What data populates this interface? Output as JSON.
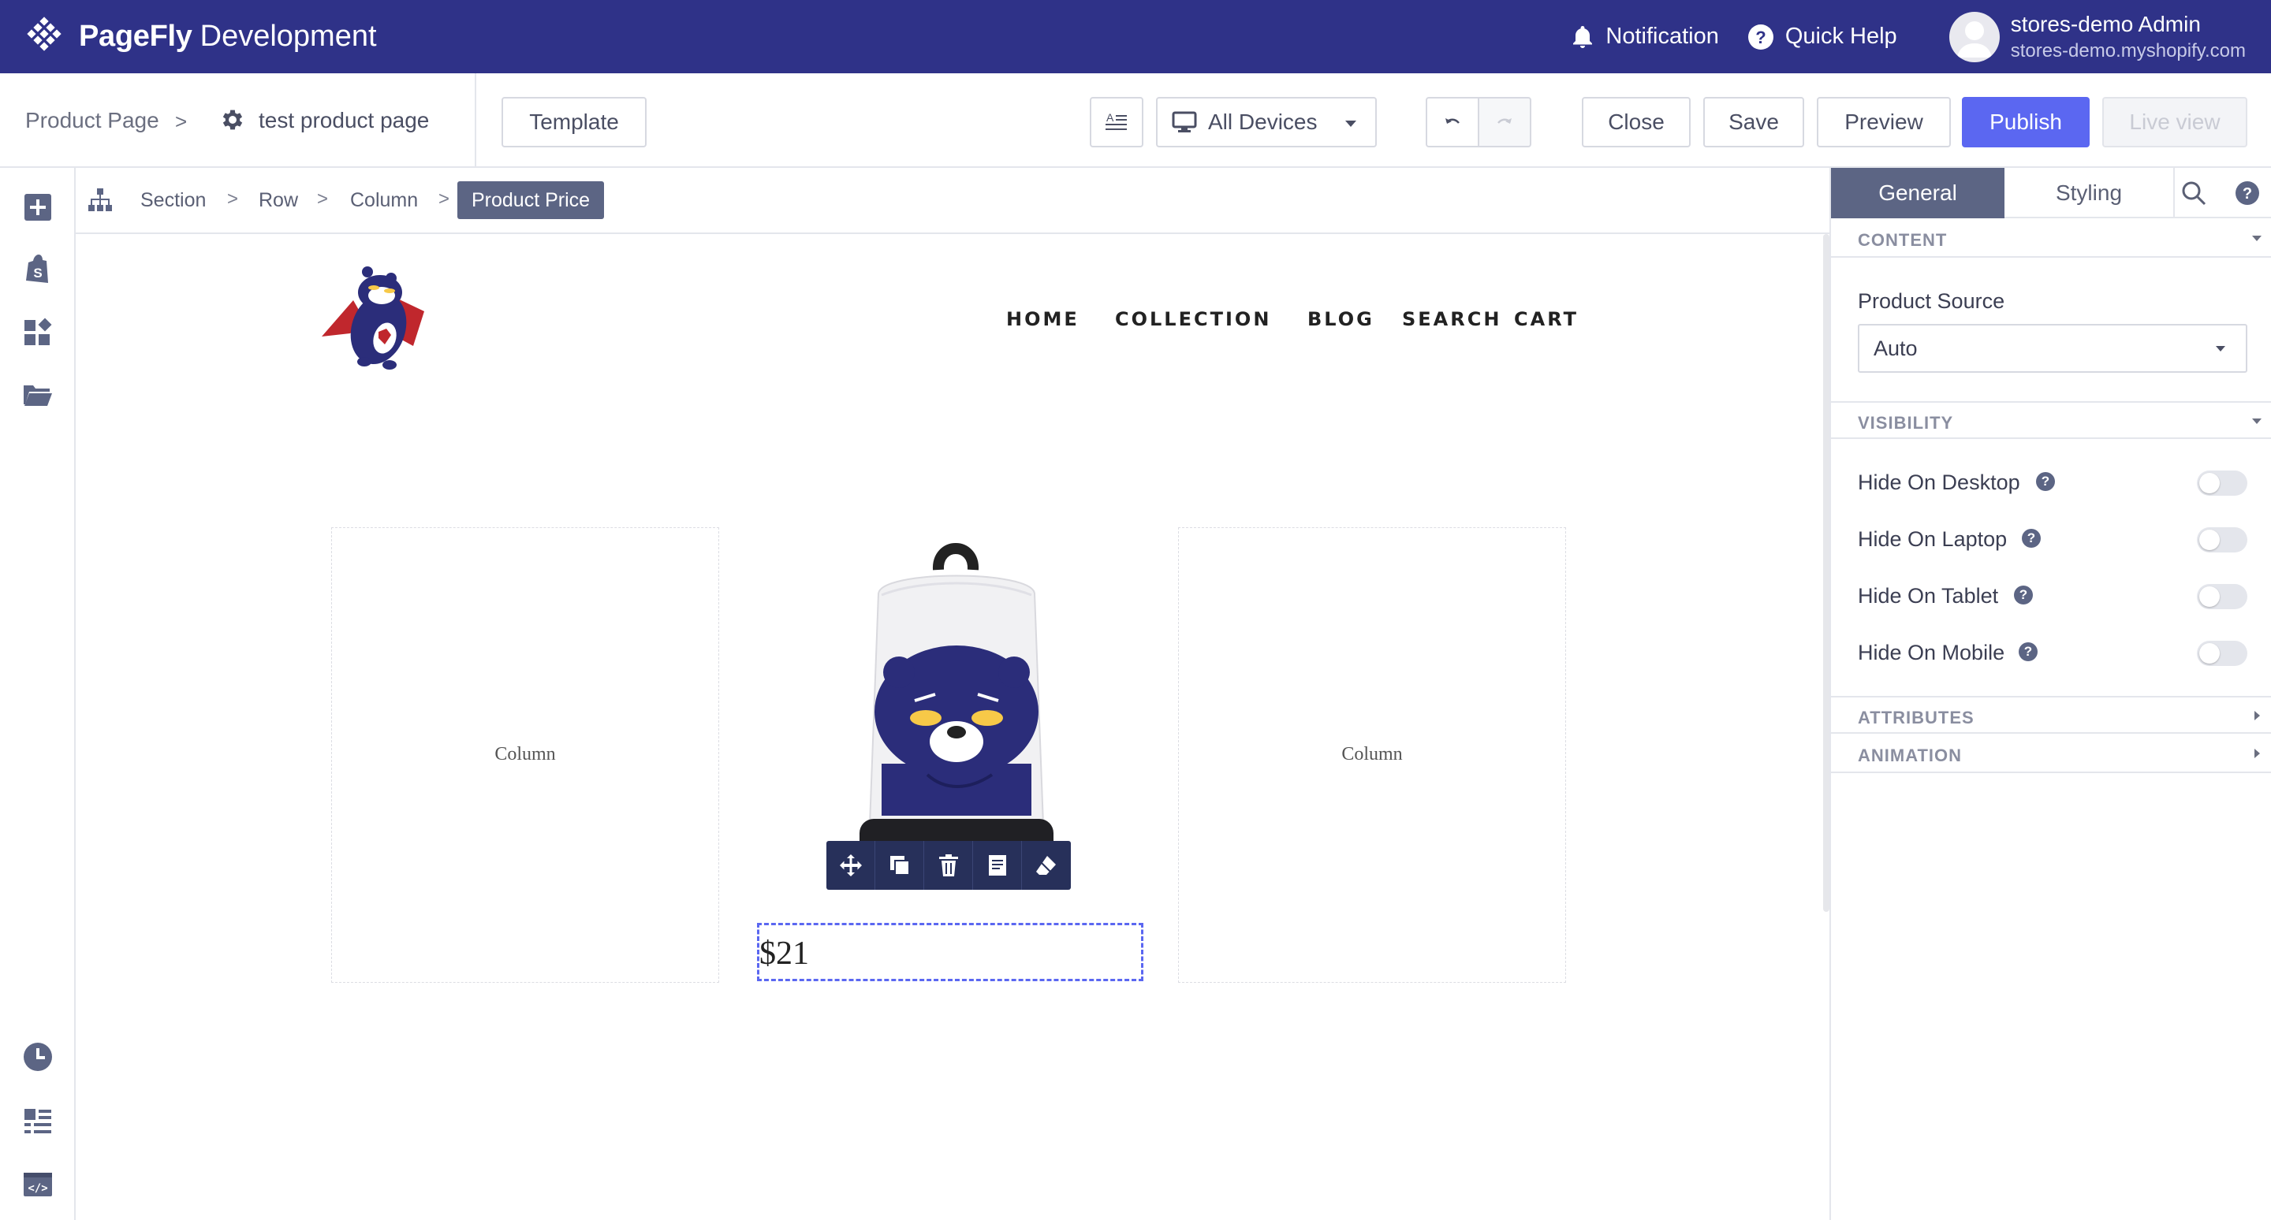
{
  "topbar": {
    "brand_name": "PageFly",
    "brand_env": "Development",
    "notification_label": "Notification",
    "quick_help_label": "Quick Help",
    "user_name": "stores-demo Admin",
    "user_domain": "stores-demo.myshopify.com",
    "bg_color": "#2f3288"
  },
  "toolbar": {
    "crumb_page": "Product Page",
    "crumb_sep": ">",
    "page_name": "test product page",
    "template_label": "Template",
    "device_label": "All Devices",
    "close_label": "Close",
    "save_label": "Save",
    "preview_label": "Preview",
    "publish_label": "Publish",
    "live_view_label": "Live view",
    "publish_color": "#5b67f1"
  },
  "left_sidebar": {
    "icons": [
      "add-element-icon",
      "shopify-bag-icon",
      "widgets-icon",
      "folder-icon",
      "history-icon",
      "outline-list-icon",
      "code-editor-icon"
    ]
  },
  "breadcrumb": {
    "items": [
      "Section",
      "Row",
      "Column"
    ],
    "sep": ">",
    "active": "Product Price"
  },
  "canvas": {
    "nav": [
      "HOME",
      "COLLECTION",
      "BLOG",
      "SEARCH",
      "CART"
    ],
    "column_left_label": "Column",
    "column_right_label": "Column",
    "price": "$21",
    "element_toolbar": [
      "move-icon",
      "duplicate-icon",
      "delete-icon",
      "save-snippet-icon",
      "eraser-icon"
    ]
  },
  "right_panel": {
    "tab_general": "General",
    "tab_styling": "Styling",
    "content_header": "CONTENT",
    "product_source_label": "Product Source",
    "product_source_value": "Auto",
    "visibility_header": "VISIBILITY",
    "visibility": [
      {
        "label": "Hide On Desktop",
        "on": false
      },
      {
        "label": "Hide On Laptop",
        "on": false
      },
      {
        "label": "Hide On Tablet",
        "on": false
      },
      {
        "label": "Hide On Mobile",
        "on": false
      }
    ],
    "attributes_header": "ATTRIBUTES",
    "animation_header": "ANIMATION"
  }
}
